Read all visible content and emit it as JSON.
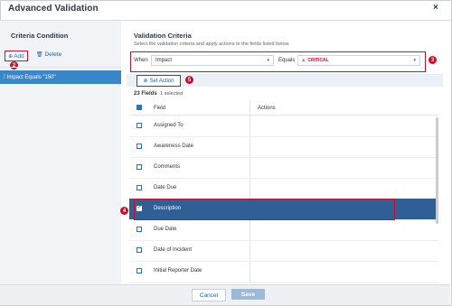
{
  "dialog": {
    "title": "Advanced Validation",
    "close_icon": "×"
  },
  "left": {
    "heading": "Criteria Condition",
    "add_label": "Add",
    "delete_label": "Delete",
    "rule_label": "Impact Equals \"150\""
  },
  "right": {
    "heading": "Validation Criteria",
    "subtitle": "Select the validation criteria and apply actions to the fields listed below",
    "when_label": "When",
    "field_value": "Impact",
    "equals_label": "Equals",
    "condition_value": "CRITICAL",
    "set_action_label": "Set Action",
    "fields_count": "23 Fields",
    "selected_count": "1 selected"
  },
  "table": {
    "columns": [
      "Field",
      "Actions"
    ],
    "rows": [
      {
        "field": "Assigned To",
        "checked": false
      },
      {
        "field": "Awareness Date",
        "checked": false
      },
      {
        "field": "Comments",
        "checked": false
      },
      {
        "field": "Date Due",
        "checked": false
      },
      {
        "field": "Description",
        "checked": true
      },
      {
        "field": "Due Date",
        "checked": false
      },
      {
        "field": "Date of Incident",
        "checked": false
      },
      {
        "field": "Initial Reporter Date",
        "checked": false
      }
    ]
  },
  "callouts": [
    "2",
    "3",
    "4",
    "5"
  ],
  "footer": {
    "cancel_label": "Cancel",
    "save_label": "Save"
  },
  "colors": {
    "accent": "#1f64a8",
    "highlight_red": "#c8102e",
    "selected_row": "#2f5f94",
    "rule_item": "#3a86c8"
  }
}
